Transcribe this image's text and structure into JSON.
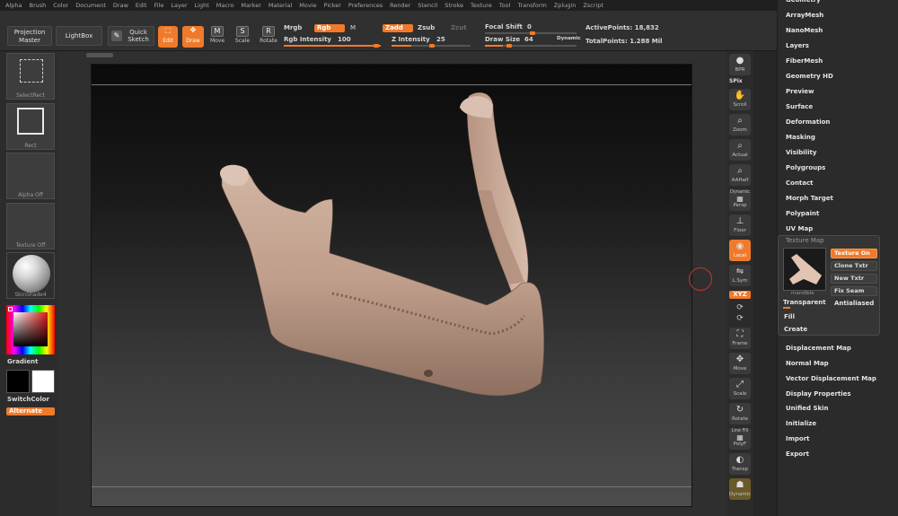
{
  "menu": [
    "Alpha",
    "Brush",
    "Color",
    "Document",
    "Draw",
    "Edit",
    "File",
    "Layer",
    "Light",
    "Macro",
    "Marker",
    "Material",
    "Movie",
    "Picker",
    "Preferences",
    "Render",
    "Stencil",
    "Stroke",
    "Texture",
    "Tool",
    "Transform",
    "Zplugin",
    "Zscript"
  ],
  "toolbar": {
    "projection_master": "Projection Master",
    "lightbox": "LightBox",
    "quick_sketch": "Quick Sketch",
    "edit": "Edit",
    "draw": "Draw",
    "move": "Move",
    "scale": "Scale",
    "rotate": "Rotate",
    "mrgb": "Mrgb",
    "rgb": "Rgb",
    "m": "M",
    "zadd": "Zadd",
    "zsub": "Zsub",
    "zcut": "Zcut",
    "rgb_intensity_label": "Rgb Intensity",
    "rgb_intensity": "100",
    "z_intensity_label": "Z Intensity",
    "z_intensity": "25",
    "focal_shift_label": "Focal Shift",
    "focal_shift": "0",
    "draw_size_label": "Draw Size",
    "draw_size": "64",
    "dynamic": "Dynamic",
    "active_points": "ActivePoints: 18,832",
    "total_points": "TotalPoints: 1.288 Mil"
  },
  "leftshelf": {
    "select_rect": "SelectRect",
    "rect": "Rect",
    "alpha": "Alpha Off",
    "texture": "Texture Off",
    "material": "SkinShade4",
    "gradient": "Gradient",
    "switch_color": "SwitchColor",
    "alternate": "Alternate"
  },
  "rightcol": {
    "bpr": "BPR",
    "spix": "SPix",
    "scroll": "Scroll",
    "zoom": "Zoom",
    "actual": "Actual",
    "aahalf": "AAHalf",
    "dynamic": "Dynamic",
    "persp": "Persp",
    "floor": "Floor",
    "local": "Local",
    "lsym": "L.Sym",
    "xyz": "XYZ",
    "frame": "Frame",
    "move": "Move",
    "scale": "Scale",
    "rotate": "Rotate",
    "line_fill": "Line Fill",
    "polyf": "PolyF",
    "transp": "Transp",
    "dynamic2": "Dynamic"
  },
  "palette": {
    "items_top": [
      "Geometry",
      "ArrayMesh",
      "NanoMesh",
      "Layers",
      "FiberMesh",
      "Geometry HD",
      "Preview",
      "Surface",
      "Deformation",
      "Masking",
      "Visibility",
      "Polygroups",
      "Contact",
      "Morph Target",
      "Polypaint",
      "UV Map"
    ],
    "texture_map": {
      "title": "Texture Map",
      "texture_on": "Texture On",
      "clone_txtr": "Clone Txtr",
      "new_txtr": "New Txtr",
      "fix_seam": "Fix Seam",
      "thumb_caption": "mandible",
      "transparent": "Transparent",
      "antialiased": "Antialiased",
      "fill": "Fill",
      "create": "Create"
    },
    "items_bottom": [
      "Displacement Map",
      "Normal Map",
      "Vector Displacement Map",
      "Display Properties",
      "Unified Skin",
      "Initialize",
      "Import",
      "Export"
    ]
  },
  "colors": {
    "accent": "#f07a2a",
    "bone": "#c9ab98"
  }
}
